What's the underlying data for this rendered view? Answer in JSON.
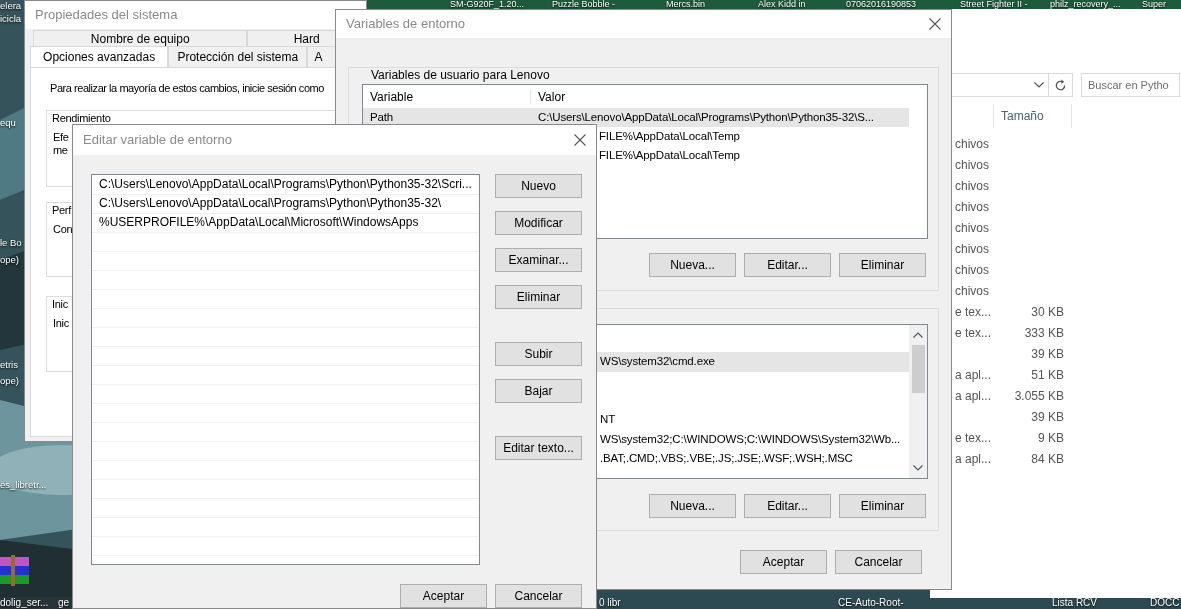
{
  "desktop": {
    "top_labels": [
      "SM-G920F_1.20...",
      "Puzzle Bobble -",
      "Mercs.bin",
      "Alex Kidd in",
      "07062016190853",
      "Street Fighter II -",
      "philz_recovery_...",
      "Super"
    ],
    "left_labels": [
      "elera",
      "icicla",
      "equ",
      "le Bo",
      "ope)",
      "etris",
      "ope)",
      "es_libretr..."
    ],
    "bottom_labels": [
      "dolig_ser...",
      "ge",
      "0 libr",
      "CE-Auto-Root-",
      "Lista RCV",
      "DOCC"
    ]
  },
  "explorer": {
    "search": {
      "placeholder": "Buscar en Pytho"
    },
    "columns": [
      "Tamaño"
    ],
    "rows": [
      {
        "type": "chivos"
      },
      {
        "type": "chivos"
      },
      {
        "type": "chivos"
      },
      {
        "type": "chivos"
      },
      {
        "type": "chivos"
      },
      {
        "type": "chivos"
      },
      {
        "type": "chivos"
      },
      {
        "type": "chivos"
      },
      {
        "type": "e tex...",
        "size": "30 KB"
      },
      {
        "type": "e tex...",
        "size": "333 KB"
      },
      {
        "size": "39 KB"
      },
      {
        "type": "a apl...",
        "size": "51 KB"
      },
      {
        "type": "a apl...",
        "size": "3.055 KB"
      },
      {
        "size": "39 KB"
      },
      {
        "type": "e tex...",
        "size": "9 KB"
      },
      {
        "type": "a apl...",
        "size": "84 KB"
      }
    ]
  },
  "system_properties": {
    "title": "Propiedades del sistema",
    "tab_rows": [
      [
        {
          "label": "Nombre de equipo",
          "selected": false
        },
        {
          "label": "Hard",
          "selected": false
        }
      ],
      [
        {
          "label": "Opciones avanzadas",
          "selected": true
        },
        {
          "label": "Protección del sistema",
          "selected": false
        },
        {
          "label": "A",
          "selected": false
        }
      ]
    ],
    "notice": "Para realizar la mayoría de estos cambios, inicie sesión como",
    "groups": [
      {
        "title": "Rendimiento",
        "lines": [
          "Efe",
          "me"
        ]
      },
      {
        "title": "Perf",
        "lines": [
          "Con"
        ]
      },
      {
        "title": "Inic",
        "lines": [
          "Inic"
        ]
      }
    ]
  },
  "environment_variables": {
    "title": "Variables de entorno",
    "user_group": {
      "title": "Variables de usuario para Lenovo",
      "columns": [
        "Variable",
        "Valor"
      ],
      "rows": [
        {
          "variable": "Path",
          "value": "C:\\Users\\Lenovo\\AppData\\Local\\Programs\\Python\\Python35-32\\S...",
          "selected": true,
          "kind": "full"
        },
        {
          "value": "FILE%\\AppData\\Local\\Temp",
          "selected": false,
          "kind": "partial"
        },
        {
          "value": "FILE%\\AppData\\Local\\Temp",
          "selected": false,
          "kind": "partial"
        }
      ],
      "buttons": [
        "Nueva...",
        "Editar...",
        "Eliminar"
      ]
    },
    "system_group": {
      "rows": [
        {
          "selected": false
        },
        {
          "value": "WS\\system32\\cmd.exe",
          "selected": true
        },
        {
          "selected": false
        },
        {
          "selected": false
        },
        {
          "value": "NT",
          "selected": false
        },
        {
          "value": "WS\\system32;C:\\WINDOWS;C:\\WINDOWS\\System32\\Wb...",
          "selected": false
        },
        {
          "value": ".BAT;.CMD;.VBS;.VBE;.JS;.JSE;.WSF;.WSH;.MSC",
          "selected": false
        }
      ],
      "buttons": [
        "Nueva...",
        "Editar...",
        "Eliminar"
      ]
    },
    "buttons": [
      "Aceptar",
      "Cancelar"
    ]
  },
  "edit_dialog": {
    "title": "Editar variable de entorno",
    "entries": [
      "C:\\Users\\Lenovo\\AppData\\Local\\Programs\\Python\\Python35-32\\Scri...",
      "C:\\Users\\Lenovo\\AppData\\Local\\Programs\\Python\\Python35-32\\",
      "%USERPROFILE%\\AppData\\Local\\Microsoft\\WindowsApps"
    ],
    "side_button_groups": [
      [
        "Nuevo",
        "Modificar",
        "Examinar...",
        "Eliminar"
      ],
      [
        "Subir",
        "Bajar"
      ],
      [
        "Editar texto..."
      ]
    ],
    "buttons": [
      "Aceptar",
      "Cancelar"
    ]
  }
}
